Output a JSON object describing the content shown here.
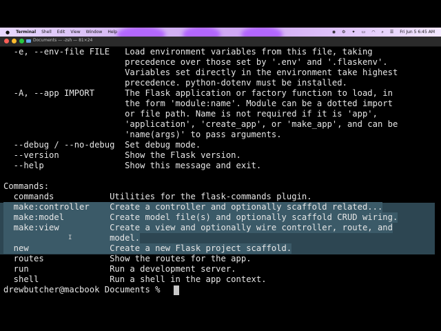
{
  "menubar": {
    "apple": "",
    "items": [
      "Terminal",
      "Shell",
      "Edit",
      "View",
      "Window",
      "Help"
    ],
    "clock": "Fri Jun 5  6:45 AM"
  },
  "window": {
    "title": "Documents — -zsh — 81×24"
  },
  "terminal": {
    "lines": [
      "  -e, --env-file FILE   Load environment variables from this file, taking",
      "                        precedence over those set by '.env' and '.flaskenv'.",
      "                        Variables set directly in the environment take highest",
      "                        precedence. python-dotenv must be installed.",
      "  -A, --app IMPORT      The Flask application or factory function to load, in",
      "                        the form 'module:name'. Module can be a dotted import",
      "                        or file path. Name is not required if it is 'app',",
      "                        'application', 'create_app', or 'make_app', and can be",
      "                        'name(args)' to pass arguments.",
      "  --debug / --no-debug  Set debug mode.",
      "  --version             Show the Flask version.",
      "  --help                Show this message and exit.",
      "",
      "Commands:",
      "  commands           Utilities for the flask-commands plugin.",
      "  make:controller    Create a controller and optionally scaffold related...",
      "  make:model         Create model file(s) and optionally scaffold CRUD wiring.",
      "  make:view          Create a view and optionally wire controller, route, and",
      "                     model.",
      "  new                Create a new Flask project scaffold.",
      "  routes             Show the routes for the app.",
      "  run                Run a development server.",
      "  shell              Run a shell in the app context.",
      "drewbutcher@macbook Documents % "
    ]
  }
}
